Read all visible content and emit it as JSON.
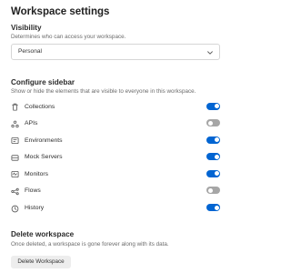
{
  "page": {
    "title": "Workspace settings"
  },
  "visibility": {
    "title": "Visibility",
    "description": "Determines who can access your workspace.",
    "selected": "Personal"
  },
  "sidebar": {
    "title": "Configure sidebar",
    "description": "Show or hide the elements that are visible to everyone in this workspace.",
    "items": [
      {
        "label": "Collections",
        "icon": "trash-icon",
        "enabled": true
      },
      {
        "label": "APIs",
        "icon": "apis-icon",
        "enabled": false
      },
      {
        "label": "Environments",
        "icon": "environments-icon",
        "enabled": true
      },
      {
        "label": "Mock Servers",
        "icon": "mock-server-icon",
        "enabled": true
      },
      {
        "label": "Monitors",
        "icon": "monitor-icon",
        "enabled": true
      },
      {
        "label": "Flows",
        "icon": "flows-icon",
        "enabled": false
      },
      {
        "label": "History",
        "icon": "history-icon",
        "enabled": true
      }
    ]
  },
  "delete": {
    "title": "Delete workspace",
    "description": "Once deleted, a workspace is gone forever along with its data.",
    "button_label": "Delete Workspace"
  },
  "colors": {
    "toggle_on": "#0265d2",
    "toggle_off": "#a6a6a6"
  }
}
